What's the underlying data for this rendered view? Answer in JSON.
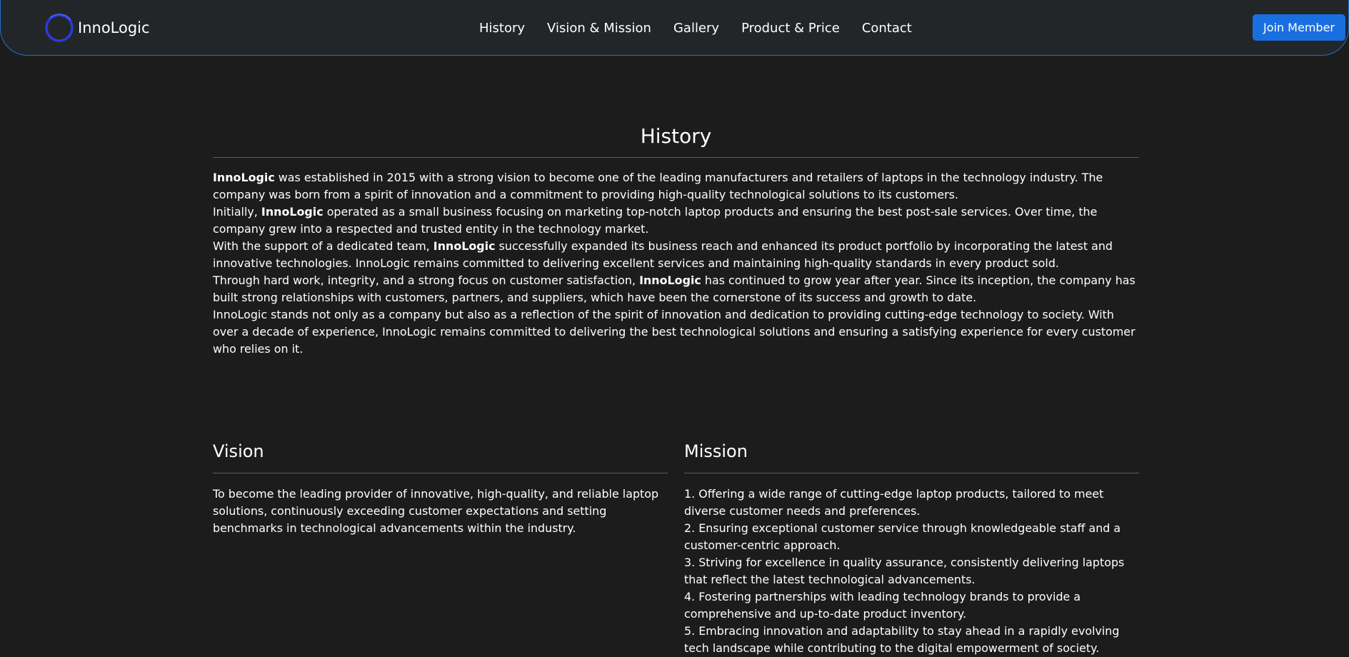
{
  "brand": {
    "name": "InnoLogic",
    "logo_icon": "ring-logo-icon",
    "accent": "#2b3bd6"
  },
  "nav": {
    "links": [
      "History",
      "Vision & Mission",
      "Gallery",
      "Product & Price",
      "Contact"
    ],
    "join_label": "Join Member",
    "border_color": "#1e6fd1",
    "button_color": "#1a6fe0"
  },
  "history": {
    "title": "History",
    "paragraphs": [
      {
        "lead": "",
        "bold": "InnoLogic",
        "rest": " was established in 2015 with a strong vision to become one of the leading manufacturers and retailers of laptops in the technology industry. The company was born from a spirit of innovation and a commitment to providing high-quality technological solutions to its customers."
      },
      {
        "lead": "Initially, ",
        "bold": "InnoLogic",
        "rest": " operated as a small business focusing on marketing top-notch laptop products and ensuring the best post-sale services. Over time, the company grew into a respected and trusted entity in the technology market."
      },
      {
        "lead": "With the support of a dedicated team, ",
        "bold": "InnoLogic",
        "rest": " successfully expanded its business reach and enhanced its product portfolio by incorporating the latest and innovative technologies. InnoLogic remains committed to delivering excellent services and maintaining high-quality standards in every product sold."
      },
      {
        "lead": "Through hard work, integrity, and a strong focus on customer satisfaction, ",
        "bold": "InnoLogic",
        "rest": " has continued to grow year after year. Since its inception, the company has built strong relationships with customers, partners, and suppliers, which have been the cornerstone of its success and growth to date."
      },
      {
        "lead": "InnoLogic stands not only as a company but also as a reflection of the spirit of innovation and dedication to providing cutting-edge technology to society. With over a decade of experience, InnoLogic remains committed to delivering the best technological solutions and ensuring a satisfying experience for every customer who relies on it.",
        "bold": "",
        "rest": ""
      }
    ]
  },
  "vision": {
    "title": "Vision",
    "text": "To become the leading provider of innovative, high-quality, and reliable laptop solutions, continuously exceeding customer expectations and setting benchmarks in technological advancements within the industry."
  },
  "mission": {
    "title": "Mission",
    "items": [
      "1. Offering a wide range of cutting-edge laptop products, tailored to meet diverse customer needs and preferences.",
      "2. Ensuring exceptional customer service through knowledgeable staff and a customer-centric approach.",
      "3. Striving for excellence in quality assurance, consistently delivering laptops that reflect the latest technological advancements.",
      "4. Fostering partnerships with leading technology brands to provide a comprehensive and up-to-date product inventory.",
      "5. Embracing innovation and adaptability to stay ahead in a rapidly evolving tech landscape while contributing to the digital empowerment of society."
    ]
  }
}
